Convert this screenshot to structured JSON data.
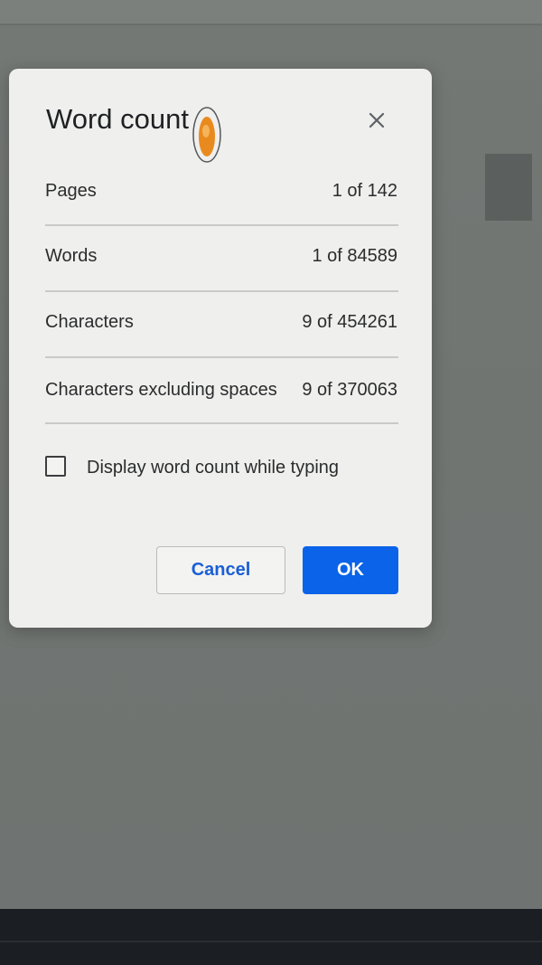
{
  "dialog": {
    "title": "Word count",
    "close_icon": "close-icon",
    "stats": [
      {
        "label": "Pages",
        "value": "1 of 142"
      },
      {
        "label": "Words",
        "value": "1 of 84589"
      },
      {
        "label": "Characters",
        "value": "9 of 454261"
      },
      {
        "label": "Characters excluding spaces",
        "value": "9 of 370063"
      }
    ],
    "checkbox": {
      "label": "Display word count while typing",
      "checked": false
    },
    "buttons": {
      "cancel": "Cancel",
      "ok": "OK"
    }
  },
  "colors": {
    "ok_button": "#0a63e8",
    "cancel_text": "#1a5fd6",
    "dialog_bg": "#efefed",
    "backdrop": "#717572"
  }
}
